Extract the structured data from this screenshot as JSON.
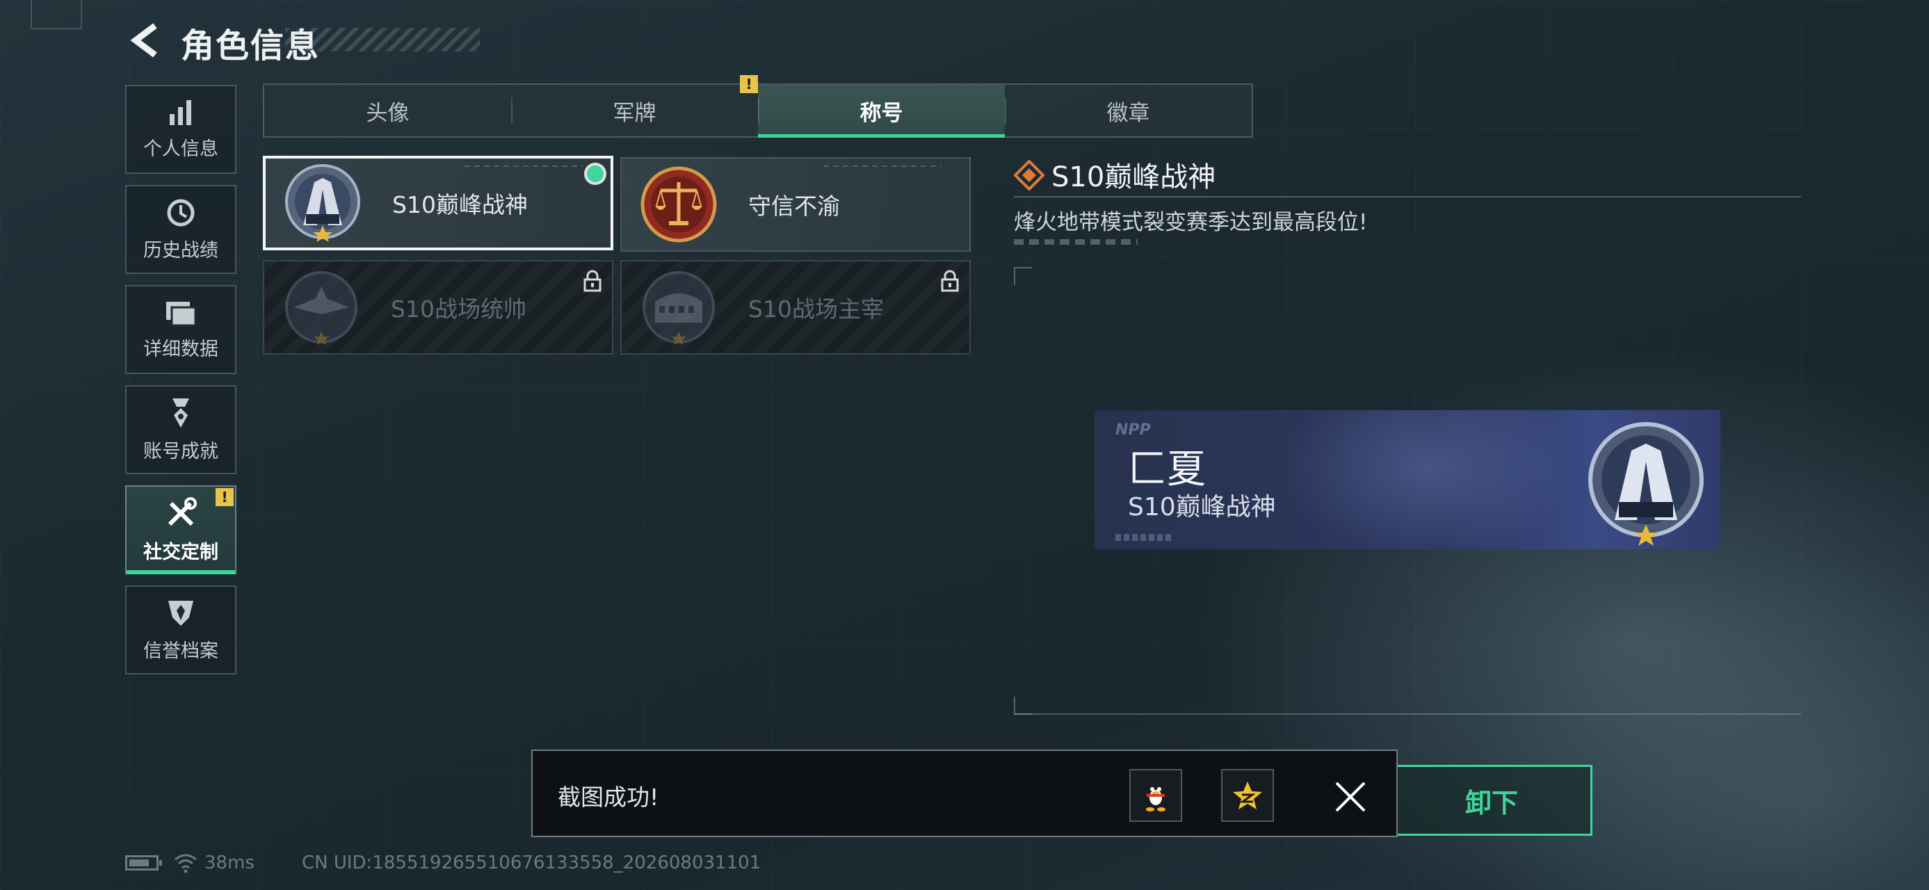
{
  "header": {
    "title": "角色信息"
  },
  "sidebar": {
    "items": [
      {
        "label": "个人信息",
        "icon": "bar-chart-icon"
      },
      {
        "label": "历史战绩",
        "icon": "history-clock-icon"
      },
      {
        "label": "详细数据",
        "icon": "folder-icon"
      },
      {
        "label": "账号成就",
        "icon": "medal-icon"
      },
      {
        "label": "社交定制",
        "icon": "tools-icon",
        "active": true,
        "alert": "!"
      },
      {
        "label": "信誉档案",
        "icon": "shield-icon"
      }
    ]
  },
  "tabs": [
    {
      "label": "头像"
    },
    {
      "label": "军牌",
      "alert": "!"
    },
    {
      "label": "称号",
      "active": true
    },
    {
      "label": "徽章"
    }
  ],
  "titles": [
    {
      "name": "S10巅峰战神",
      "selected": true,
      "equipped": true,
      "locked": false
    },
    {
      "name": "守信不渝",
      "selected": false,
      "equipped": false,
      "locked": false
    },
    {
      "name": "S10战场统帅",
      "selected": false,
      "equipped": false,
      "locked": true
    },
    {
      "name": "S10战场主宰",
      "selected": false,
      "equipped": false,
      "locked": true
    }
  ],
  "detail": {
    "title": "S10巅峰战神",
    "description": "烽火地带模式裂变赛季达到最高段位!"
  },
  "banner": {
    "logo": "NPP",
    "player_name": "匚夏",
    "title": "S10巅峰战神"
  },
  "unequip_label": "卸下",
  "toast": {
    "message": "截图成功!"
  },
  "status": {
    "ping": "38ms",
    "uid": "CN UID:18551926551067613355​8_202608031101"
  },
  "colors": {
    "accent": "#3ed69a",
    "alert": "#e8c44a",
    "banner": "#2b3760"
  }
}
